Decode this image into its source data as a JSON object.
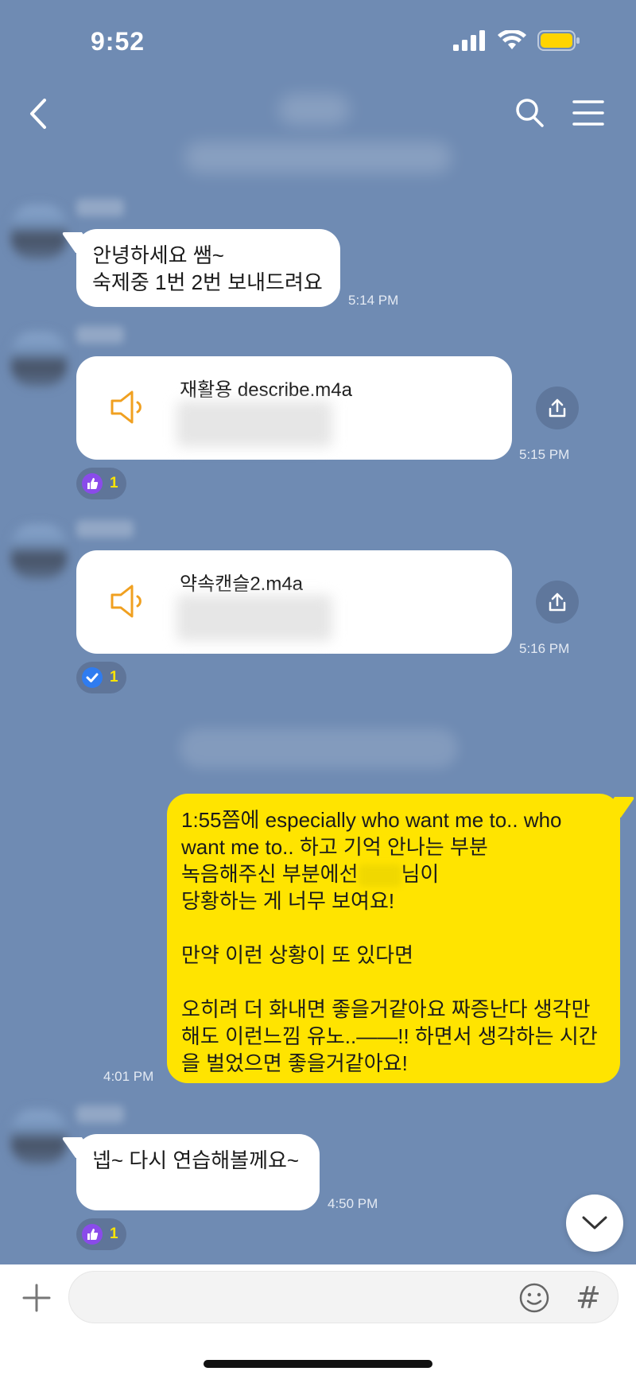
{
  "status_bar": {
    "time": "9:52"
  },
  "header": {
    "title": "",
    "subtitle": ""
  },
  "messages": [
    {
      "type": "text",
      "text": "안녕하세요 쌤~\n숙제중 1번 2번 보내드려요",
      "time": "5:14 PM"
    },
    {
      "type": "file",
      "file_name": "재활용 describe.m4a",
      "time": "5:15 PM",
      "reaction": {
        "icon": "thumbs-up-icon",
        "count": "1"
      }
    },
    {
      "type": "file",
      "file_name": "약속캔슬2.m4a",
      "time": "5:16 PM",
      "reaction": {
        "icon": "check-icon",
        "count": "1"
      }
    },
    {
      "type": "text_mine",
      "line1": "1:55쯤에 especially who want me to.. who want me to.. 하고 기억 안나는 부분",
      "line2_prefix": "녹음해주신 부분에선",
      "line2_suffix": "님이",
      "line3": "당황하는 게 너무 보여요!",
      "line4": "만약 이런 상황이 또 있다면",
      "line5": "오히려 더 화내면 좋을거같아요 짜증난다 생각만 해도  이런느낌 유노..——!! 하면서 생각하는 시간을 벌었으면 좋을거같아요!",
      "time": "4:01 PM"
    },
    {
      "type": "text",
      "text": "넵~ 다시 연습해볼께요~",
      "time": "4:50 PM",
      "reaction": {
        "icon": "thumbs-up-icon",
        "count": "1"
      }
    }
  ],
  "input": {
    "placeholder": ""
  },
  "colors": {
    "background": "#6f8bb3",
    "my_bubble": "#ffe400",
    "other_bubble": "#ffffff",
    "reaction_count": "#ffe400",
    "audio_icon": "#f0a020"
  }
}
